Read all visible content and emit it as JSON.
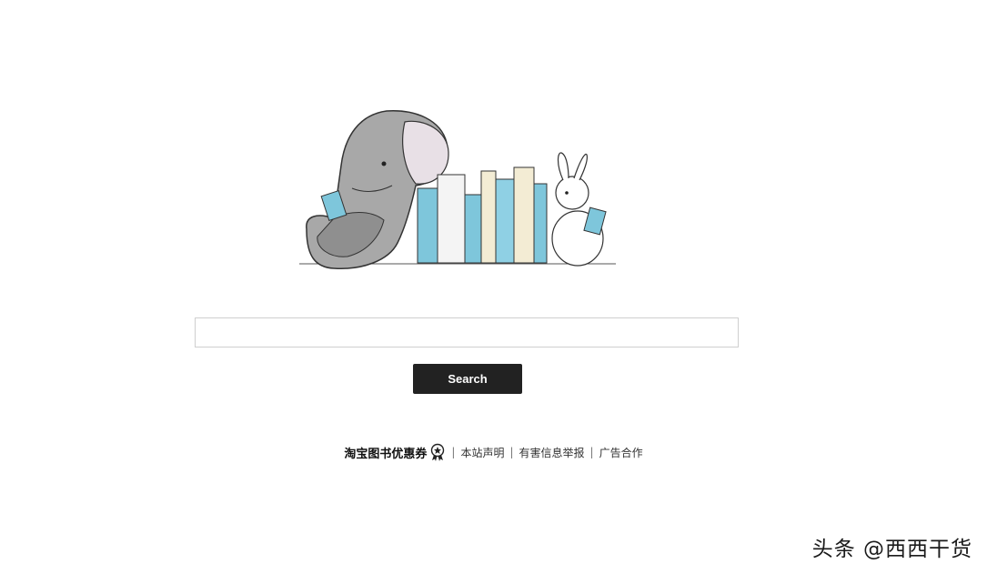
{
  "search": {
    "placeholder": "",
    "value": "",
    "button_label": "Search"
  },
  "hero": {
    "icon": "elephant-rabbit-reading-books-illustration"
  },
  "footer": {
    "promo_label": "淘宝图书优惠券",
    "promo_icon": "coupon-badge-icon",
    "links": [
      "本站声明",
      "有害信息举报",
      "广告合作"
    ],
    "separator": "|"
  },
  "watermark": {
    "text": "头条 @西西干货"
  },
  "colors": {
    "button_bg": "#222222",
    "input_border": "#cfcfcf",
    "book_blue": "#7ec6db",
    "book_cream": "#f3ecd4"
  }
}
